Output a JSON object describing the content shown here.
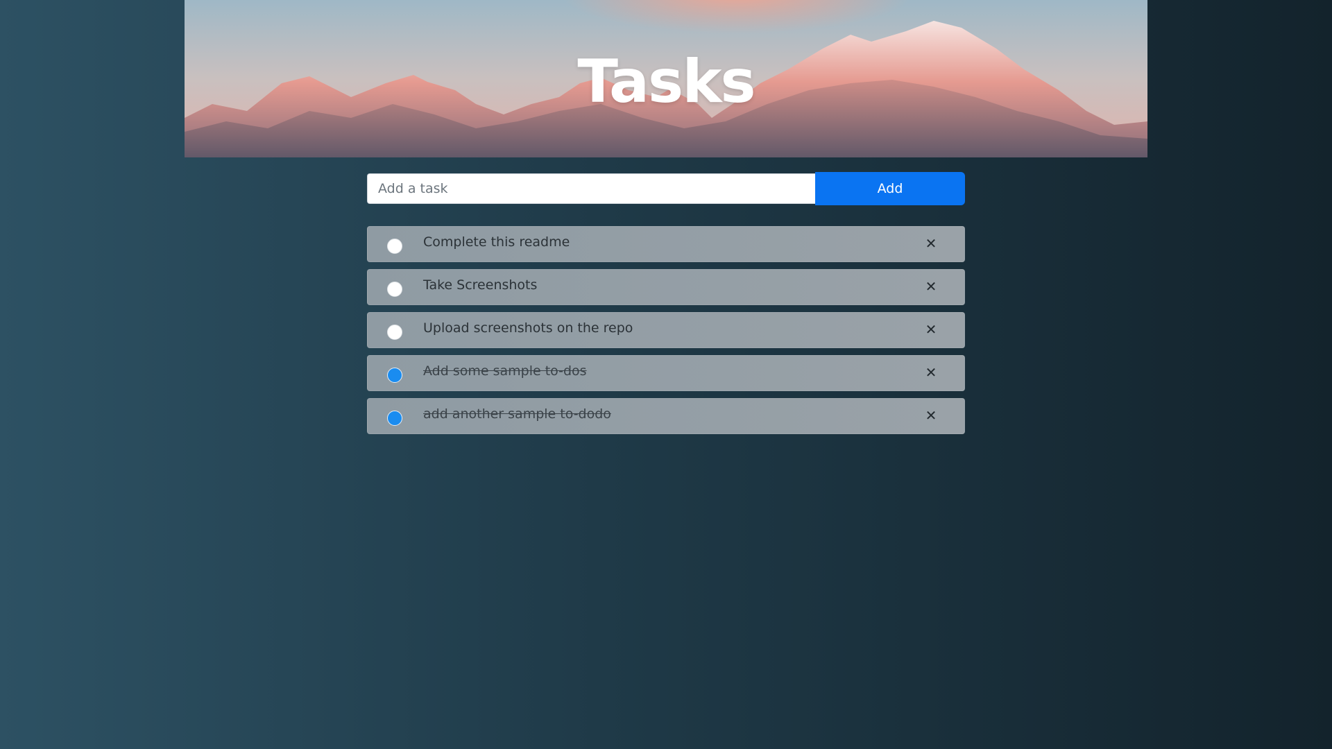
{
  "header": {
    "title": "Tasks"
  },
  "add_form": {
    "input_placeholder": "Add a task",
    "input_value": "",
    "add_label": "Add"
  },
  "tasks": [
    {
      "label": "Complete this readme",
      "completed": false
    },
    {
      "label": "Take Screenshots",
      "completed": false
    },
    {
      "label": "Upload screenshots on the repo",
      "completed": false
    },
    {
      "label": "Add some sample to-dos",
      "completed": true
    },
    {
      "label": "add another sample to-dodo",
      "completed": true
    }
  ],
  "icons": {
    "delete": "close-icon",
    "toggle": "circle-checkbox-icon"
  },
  "colors": {
    "accent": "#0a74f2",
    "done_check": "#1a8cf0",
    "title_text": "#ffffff"
  }
}
